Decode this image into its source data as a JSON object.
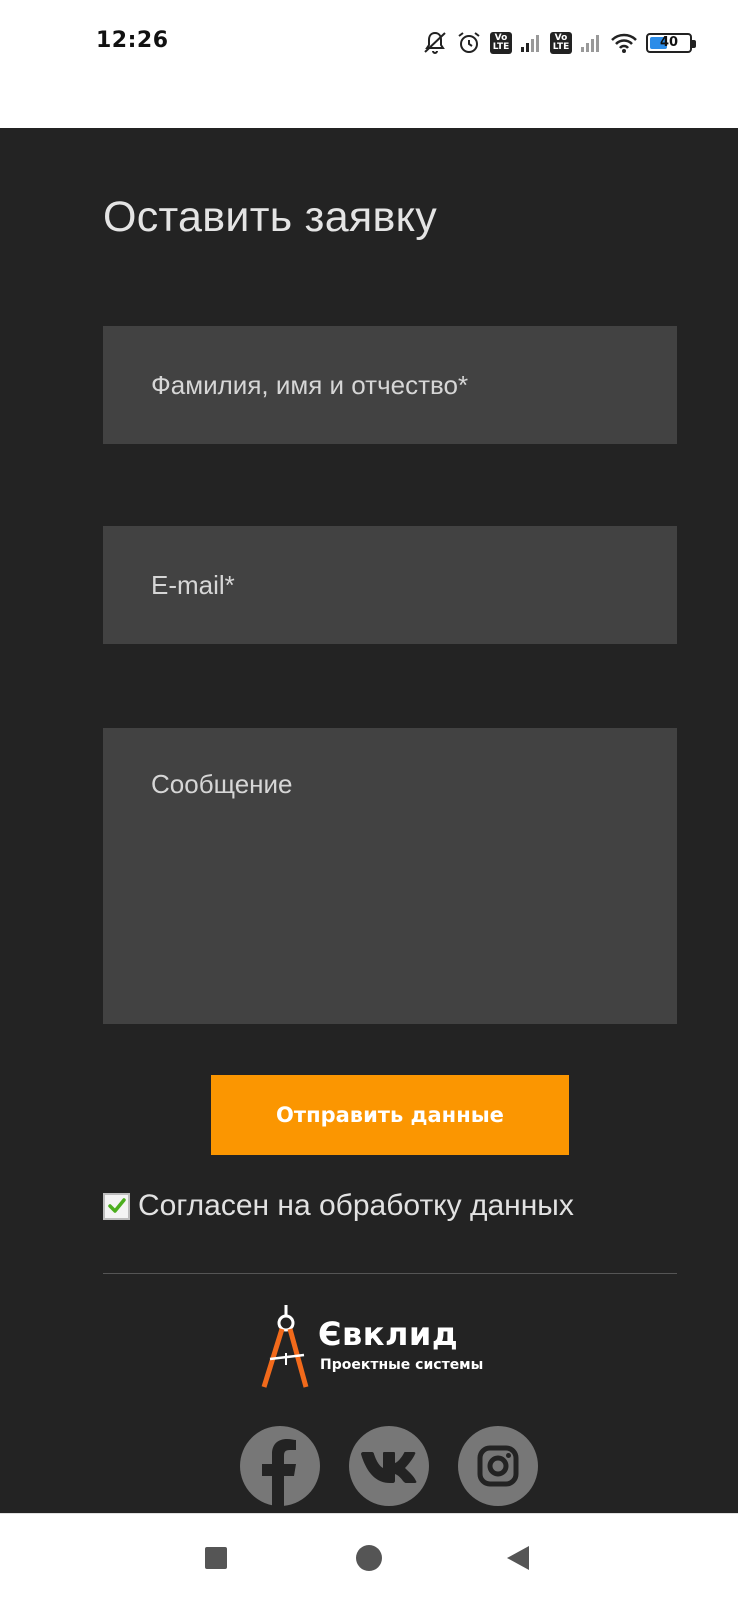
{
  "status_bar": {
    "time": "12:26",
    "volte1": "Vo LTE",
    "volte2": "Vo LTE",
    "battery_percent": "40"
  },
  "form": {
    "title": "Оставить заявку",
    "name_placeholder": "Фамилия, имя и отчество*",
    "email_placeholder": "E-mail*",
    "message_placeholder": "Сообщение",
    "submit_label": "Отправить данные",
    "consent_label": "Согласен на обработку данных",
    "consent_checked": true
  },
  "footer": {
    "logo_name": "Євклид",
    "logo_tagline": "Проектные системы",
    "socials": [
      "facebook-icon",
      "vk-icon",
      "instagram-icon"
    ]
  },
  "colors": {
    "background": "#232323",
    "field": "#424242",
    "accent": "#fb9601",
    "social": "#777777"
  }
}
